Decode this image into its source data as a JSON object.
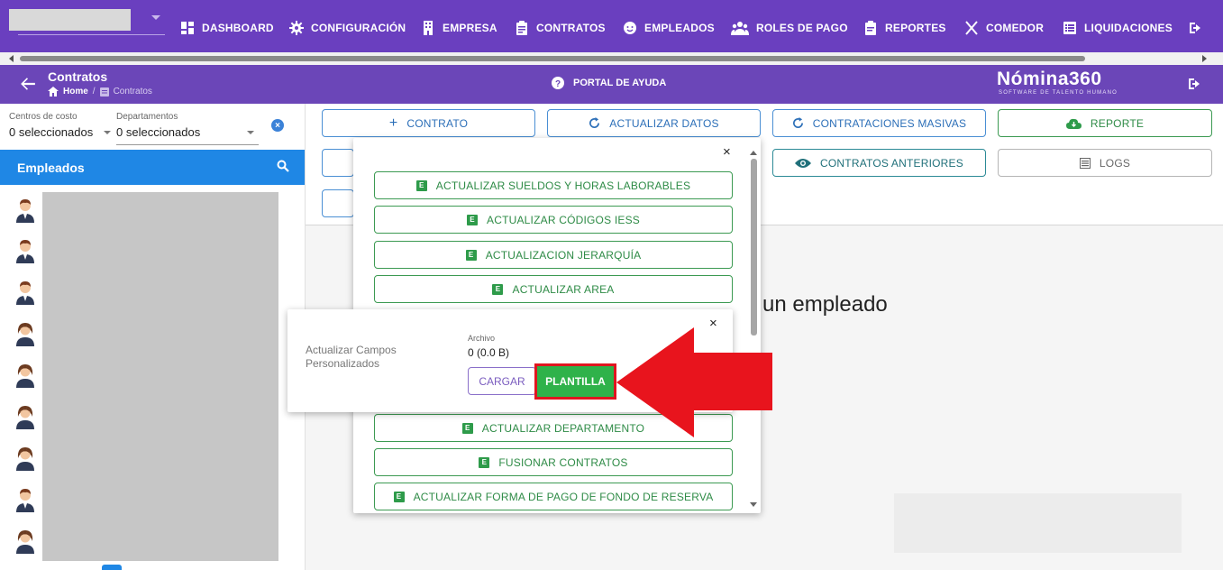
{
  "nav": {
    "items": [
      {
        "label": "DASHBOARD",
        "icon": "dashboard-icon"
      },
      {
        "label": "CONFIGURACIÓN",
        "icon": "gear-icon"
      },
      {
        "label": "EMPRESA",
        "icon": "building-icon"
      },
      {
        "label": "CONTRATOS",
        "icon": "clipboard-icon"
      },
      {
        "label": "EMPLEADOS",
        "icon": "face-icon"
      },
      {
        "label": "ROLES DE PAGO",
        "icon": "group-icon"
      },
      {
        "label": "REPORTES",
        "icon": "report-icon"
      },
      {
        "label": "COMEDOR",
        "icon": "utensils-icon"
      },
      {
        "label": "LIQUIDACIONES",
        "icon": "list-icon"
      }
    ]
  },
  "header": {
    "title": "Contratos",
    "breadcrumb_home": "Home",
    "breadcrumb_sep": "/",
    "breadcrumb_current": "Contratos",
    "help_label": "PORTAL DE AYUDA",
    "brand": "Nómina360",
    "brand_sub": "SOFTWARE DE TALENTO HUMANO"
  },
  "filters": {
    "cost_centers_label": "Centros de costo",
    "cost_centers_value": "0 seleccionados",
    "departments_label": "Departamentos",
    "departments_value": "0 seleccionados",
    "clear_glyph": "×"
  },
  "sidebar": {
    "title": "Empleados"
  },
  "toolbar": {
    "contract": "CONTRATO",
    "refresh": "ACTUALIZAR DATOS",
    "bulk": "CONTRATACIONES MASIVAS",
    "report": "REPORTE",
    "previous": "CONTRATOS ANTERIORES",
    "logs": "LOGS"
  },
  "main": {
    "empty_text": "un empleado"
  },
  "menu": {
    "close": "×",
    "items": [
      "ACTUALIZAR SUELDOS Y HORAS LABORABLES",
      "ACTUALIZAR CÓDIGOS IESS",
      "ACTUALIZACION JERARQUÍA",
      "ACTUALIZAR AREA",
      "ACTUALIZAR DEPARTAMENTO",
      "FUSIONAR CONTRATOS",
      "ACTUALIZAR FORMA DE PAGO DE FONDO DE RESERVA"
    ],
    "xls_glyph": "E"
  },
  "popup": {
    "title": "Actualizar Campos Personalizados",
    "file_label": "Archivo",
    "file_value": "0 (0.0 B)",
    "load_button": "CARGAR",
    "template_button": "PLANTILLA",
    "close": "×"
  },
  "colors": {
    "nav_bg": "#6a3fbf",
    "sidebar_header": "#1f87e5",
    "green": "#2e8b46",
    "highlight_red": "#e0151f"
  }
}
